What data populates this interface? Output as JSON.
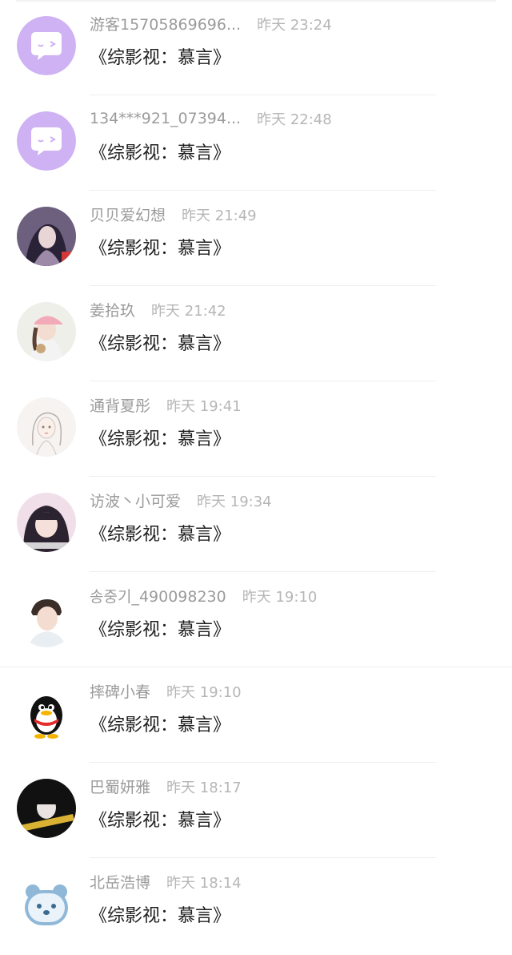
{
  "comments": [
    {
      "avatar": "chat-bubble-avatar",
      "name": "游客15705869696...",
      "time": "昨天 23:24",
      "title": "《综影视：慕言》"
    },
    {
      "avatar": "chat-bubble-avatar",
      "name": "134***921_07394...",
      "time": "昨天 22:48",
      "title": "《综影视：慕言》"
    },
    {
      "avatar": "anime-girl-avatar",
      "name": "贝贝爱幻想",
      "time": "昨天 21:49",
      "title": "《综影视：慕言》"
    },
    {
      "avatar": "girl-pink-cap-avatar",
      "name": "姜拾玖",
      "time": "昨天 21:42",
      "title": "《综影视：慕言》"
    },
    {
      "avatar": "sketch-girl-avatar",
      "name": "通背夏彤",
      "time": "昨天 19:41",
      "title": "《综影视：慕言》"
    },
    {
      "avatar": "girl-portrait-avatar",
      "name": "访波丶小可爱",
      "time": "昨天 19:34",
      "title": "《综影视：慕言》"
    },
    {
      "avatar": "boy-portrait-avatar",
      "name": "송중기_490098230",
      "time": "昨天 19:10",
      "title": "《综影视：慕言》"
    },
    {
      "avatar": "qq-penguin-avatar",
      "name": "摔碑小春",
      "time": "昨天 19:10",
      "title": "《综影视：慕言》"
    },
    {
      "avatar": "dark-girl-avatar",
      "name": "巴蜀妍雅",
      "time": "昨天 18:17",
      "title": "《综影视：慕言》"
    },
    {
      "avatar": "bear-avatar",
      "name": "北岳浩博",
      "time": "昨天 18:14",
      "title": "《综影视：慕言》"
    }
  ],
  "colors": {
    "chat_bubble_bg": "#ceb2f4",
    "name_text": "#9b9b9b",
    "time_text": "#b6b6b6",
    "title_text": "#1f1f1f"
  }
}
